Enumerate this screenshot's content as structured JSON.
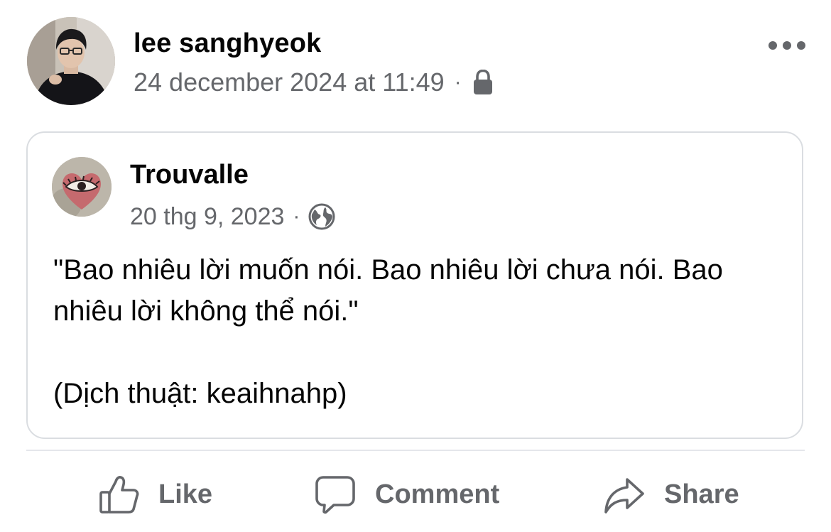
{
  "post": {
    "author": "lee sanghyeok",
    "timestamp": "24 december 2024 at 11:49",
    "separator": "·",
    "privacy_icon": "lock-icon",
    "menu_icon": "more-options-icon"
  },
  "shared_post": {
    "author": "Trouvalle",
    "timestamp": "20 thg 9, 2023",
    "separator": "·",
    "privacy_icon": "globe-icon",
    "quote": "\"Bao nhiêu lời muốn nói. Bao nhiêu lời chưa nói. Bao nhiêu lời không thể nói.\"",
    "credit": "(Dịch thuật: keaihnahp)"
  },
  "actions": {
    "like_label": "Like",
    "comment_label": "Comment",
    "share_label": "Share"
  },
  "colors": {
    "primary_text": "#050505",
    "secondary_text": "#65676b",
    "card_border": "#dadde1",
    "divider": "#e4e6eb"
  }
}
